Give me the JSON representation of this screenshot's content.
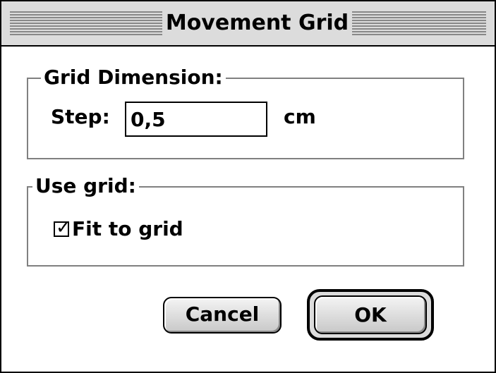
{
  "window": {
    "title": "Movement Grid"
  },
  "grid_dimension": {
    "group_label": "Grid Dimension:",
    "step_label": "Step:",
    "step_value": "0,5",
    "unit": "cm"
  },
  "use_grid": {
    "group_label": "Use grid:",
    "fit_to_grid_label": "Fit to grid",
    "fit_to_grid_checked": true,
    "check_glyph": "✓"
  },
  "buttons": {
    "cancel_label": "Cancel",
    "ok_label": "OK"
  },
  "colors": {
    "titlebar": "#dcdcdc",
    "group_border": "#808080"
  }
}
